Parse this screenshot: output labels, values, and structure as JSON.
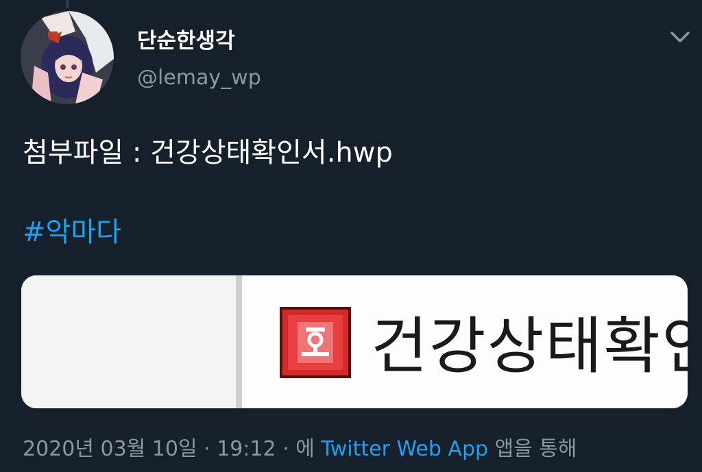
{
  "user": {
    "display_name": "단순한생각",
    "handle": "@lemay_wp"
  },
  "icons": {
    "menu": "chevron-down-icon",
    "file_type": "hwp-file-icon"
  },
  "tweet": {
    "text": "첨부파일 : 건강상태확인서.hwp",
    "hashtag": "#악마다"
  },
  "media": {
    "file_name": "건강상태확인"
  },
  "meta": {
    "date": "2020년 03월 10일",
    "separator1": " · ",
    "time": "19:12",
    "separator2": " · ",
    "via_prefix": "에 ",
    "app": "Twitter Web App",
    "via_suffix": " 앱을 통해"
  },
  "colors": {
    "background": "#15202b",
    "accent": "#1da1f2",
    "secondary_text": "#8899a6"
  }
}
